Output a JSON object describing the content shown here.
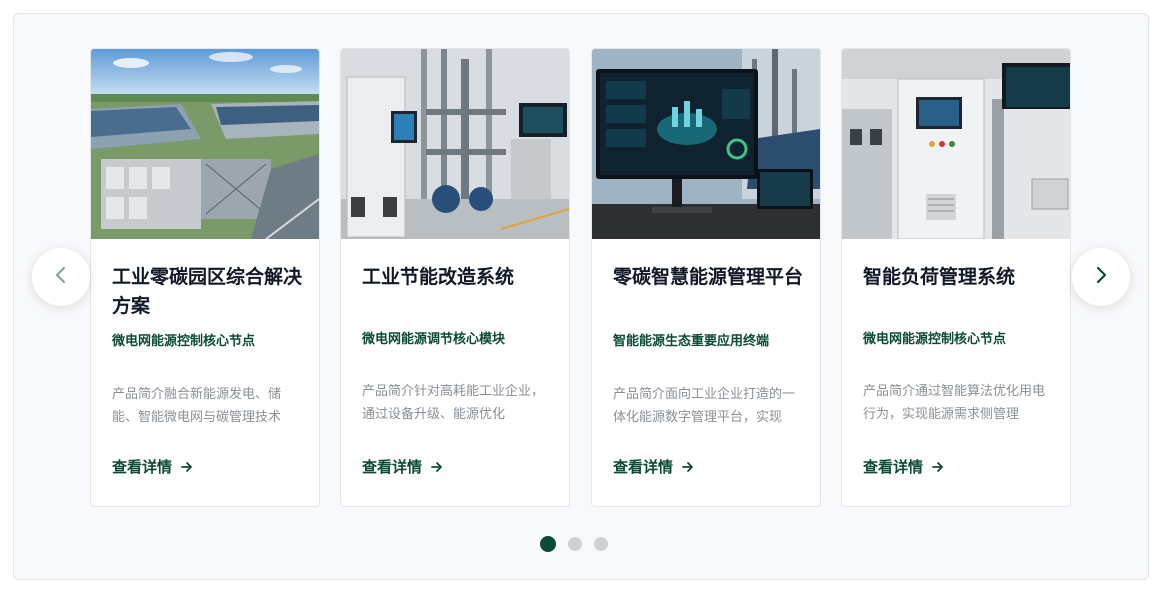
{
  "carousel": {
    "prev_label": "‹",
    "next_label": "›",
    "cards": [
      {
        "title": "工业零碳园区综合解决方案",
        "subtitle": "微电网能源控制核心节点",
        "description": "产品简介融合新能源发电、储能、智能微电网与碳管理技术",
        "link_label": "查看详情"
      },
      {
        "title": "工业节能改造系统",
        "subtitle": "微电网能源调节核心模块",
        "description": "产品简介针对高耗能工业企业，通过设备升级、能源优化",
        "link_label": "查看详情"
      },
      {
        "title": "零碳智慧能源管理平台",
        "subtitle": "智能能源生态重要应用终端",
        "description": "产品简介面向工业企业打造的一体化能源数字管理平台，实现",
        "link_label": "查看详情"
      },
      {
        "title": "智能负荷管理系统",
        "subtitle": "微电网能源控制核心节点",
        "description": "产品简介通过智能算法优化用电行为，实现能源需求侧管理",
        "link_label": "查看详情"
      }
    ],
    "pagination": {
      "total": 3,
      "active": 0
    }
  },
  "colors": {
    "accent": "#0e4a38",
    "title": "#111827",
    "muted": "#8a8f98",
    "dot_inactive": "#cdd2d8"
  }
}
